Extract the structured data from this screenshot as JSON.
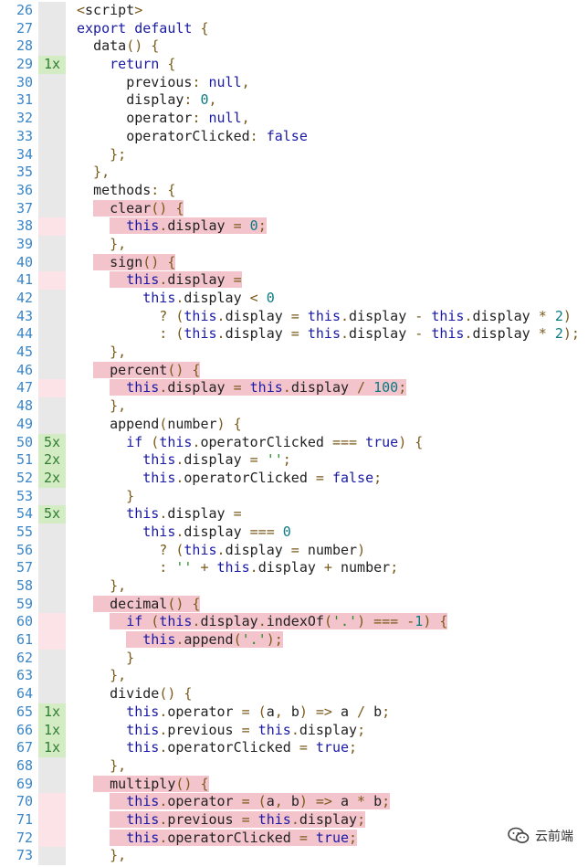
{
  "lines": [
    {
      "n": "26",
      "cov": "",
      "state": "none",
      "code": "<script>",
      "hl": 0
    },
    {
      "n": "27",
      "cov": "",
      "state": "none",
      "code": "export default {",
      "hl": 0
    },
    {
      "n": "28",
      "cov": "",
      "state": "none",
      "code": "  data() {",
      "hl": 0
    },
    {
      "n": "29",
      "cov": "1x",
      "state": "hit",
      "code": "    return {",
      "hl": 0
    },
    {
      "n": "30",
      "cov": "",
      "state": "none",
      "code": "      previous: null,",
      "hl": 0
    },
    {
      "n": "31",
      "cov": "",
      "state": "none",
      "code": "      display: 0,",
      "hl": 0
    },
    {
      "n": "32",
      "cov": "",
      "state": "none",
      "code": "      operator: null,",
      "hl": 0
    },
    {
      "n": "33",
      "cov": "",
      "state": "none",
      "code": "      operatorClicked: false",
      "hl": 0
    },
    {
      "n": "34",
      "cov": "",
      "state": "none",
      "code": "    };",
      "hl": 0
    },
    {
      "n": "35",
      "cov": "",
      "state": "none",
      "code": "  },",
      "hl": 0
    },
    {
      "n": "36",
      "cov": "",
      "state": "none",
      "code": "  methods: {",
      "hl": 0
    },
    {
      "n": "37",
      "cov": "",
      "state": "none",
      "code": "    clear() {",
      "hl": 1
    },
    {
      "n": "38",
      "cov": "",
      "state": "miss",
      "code": "      this.display = 0;",
      "hl": 1
    },
    {
      "n": "39",
      "cov": "",
      "state": "none",
      "code": "    },",
      "hl": 0
    },
    {
      "n": "40",
      "cov": "",
      "state": "none",
      "code": "    sign() {",
      "hl": 1
    },
    {
      "n": "41",
      "cov": "",
      "state": "miss",
      "code": "      this.display =",
      "hl": 1
    },
    {
      "n": "42",
      "cov": "",
      "state": "none",
      "code": "        this.display < 0",
      "hl": 0
    },
    {
      "n": "43",
      "cov": "",
      "state": "none",
      "code": "          ? (this.display = this.display - this.display * 2)",
      "hl": 0
    },
    {
      "n": "44",
      "cov": "",
      "state": "none",
      "code": "          : (this.display = this.display - this.display * 2);",
      "hl": 0
    },
    {
      "n": "45",
      "cov": "",
      "state": "none",
      "code": "    },",
      "hl": 0
    },
    {
      "n": "46",
      "cov": "",
      "state": "none",
      "code": "    percent() {",
      "hl": 1
    },
    {
      "n": "47",
      "cov": "",
      "state": "miss",
      "code": "      this.display = this.display / 100;",
      "hl": 1
    },
    {
      "n": "48",
      "cov": "",
      "state": "none",
      "code": "    },",
      "hl": 0
    },
    {
      "n": "49",
      "cov": "",
      "state": "none",
      "code": "    append(number) {",
      "hl": 0
    },
    {
      "n": "50",
      "cov": "5x",
      "state": "hit",
      "code": "      if (this.operatorClicked === true) {",
      "hl": 0
    },
    {
      "n": "51",
      "cov": "2x",
      "state": "hit",
      "code": "        this.display = '';",
      "hl": 0
    },
    {
      "n": "52",
      "cov": "2x",
      "state": "hit",
      "code": "        this.operatorClicked = false;",
      "hl": 0
    },
    {
      "n": "53",
      "cov": "",
      "state": "none",
      "code": "      }",
      "hl": 0
    },
    {
      "n": "54",
      "cov": "5x",
      "state": "hit",
      "code": "      this.display =",
      "hl": 0
    },
    {
      "n": "55",
      "cov": "",
      "state": "none",
      "code": "        this.display === 0",
      "hl": 0
    },
    {
      "n": "56",
      "cov": "",
      "state": "none",
      "code": "          ? (this.display = number)",
      "hl": 0
    },
    {
      "n": "57",
      "cov": "",
      "state": "none",
      "code": "          : '' + this.display + number;",
      "hl": 0
    },
    {
      "n": "58",
      "cov": "",
      "state": "none",
      "code": "    },",
      "hl": 0
    },
    {
      "n": "59",
      "cov": "",
      "state": "none",
      "code": "    decimal() {",
      "hl": 1
    },
    {
      "n": "60",
      "cov": "",
      "state": "miss",
      "code": "      if (this.display.indexOf('.') === -1) {",
      "hl": 1
    },
    {
      "n": "61",
      "cov": "",
      "state": "miss",
      "code": "        this.append('.');",
      "hl": 1
    },
    {
      "n": "62",
      "cov": "",
      "state": "none",
      "code": "      }",
      "hl": 0
    },
    {
      "n": "63",
      "cov": "",
      "state": "none",
      "code": "    },",
      "hl": 0
    },
    {
      "n": "64",
      "cov": "",
      "state": "none",
      "code": "    divide() {",
      "hl": 0
    },
    {
      "n": "65",
      "cov": "1x",
      "state": "hit",
      "code": "      this.operator = (a, b) => a / b;",
      "hl": 0
    },
    {
      "n": "66",
      "cov": "1x",
      "state": "hit",
      "code": "      this.previous = this.display;",
      "hl": 0
    },
    {
      "n": "67",
      "cov": "1x",
      "state": "hit",
      "code": "      this.operatorClicked = true;",
      "hl": 0
    },
    {
      "n": "68",
      "cov": "",
      "state": "none",
      "code": "    },",
      "hl": 0
    },
    {
      "n": "69",
      "cov": "",
      "state": "none",
      "code": "    multiply() {",
      "hl": 1
    },
    {
      "n": "70",
      "cov": "",
      "state": "miss",
      "code": "      this.operator = (a, b) => a * b;",
      "hl": 1
    },
    {
      "n": "71",
      "cov": "",
      "state": "miss",
      "code": "      this.previous = this.display;",
      "hl": 1
    },
    {
      "n": "72",
      "cov": "",
      "state": "miss",
      "code": "      this.operatorClicked = true;",
      "hl": 1
    },
    {
      "n": "73",
      "cov": "",
      "state": "none",
      "code": "    },",
      "hl": 0
    }
  ],
  "watermark": {
    "text": "云前端",
    "icon": "wechat-icon"
  },
  "colors": {
    "line_number": "#3a86c8",
    "hit_bg": "#d4ecc4",
    "miss_bg": "#fbe3e8",
    "uncovered_highlight": "#f3c4cc"
  }
}
